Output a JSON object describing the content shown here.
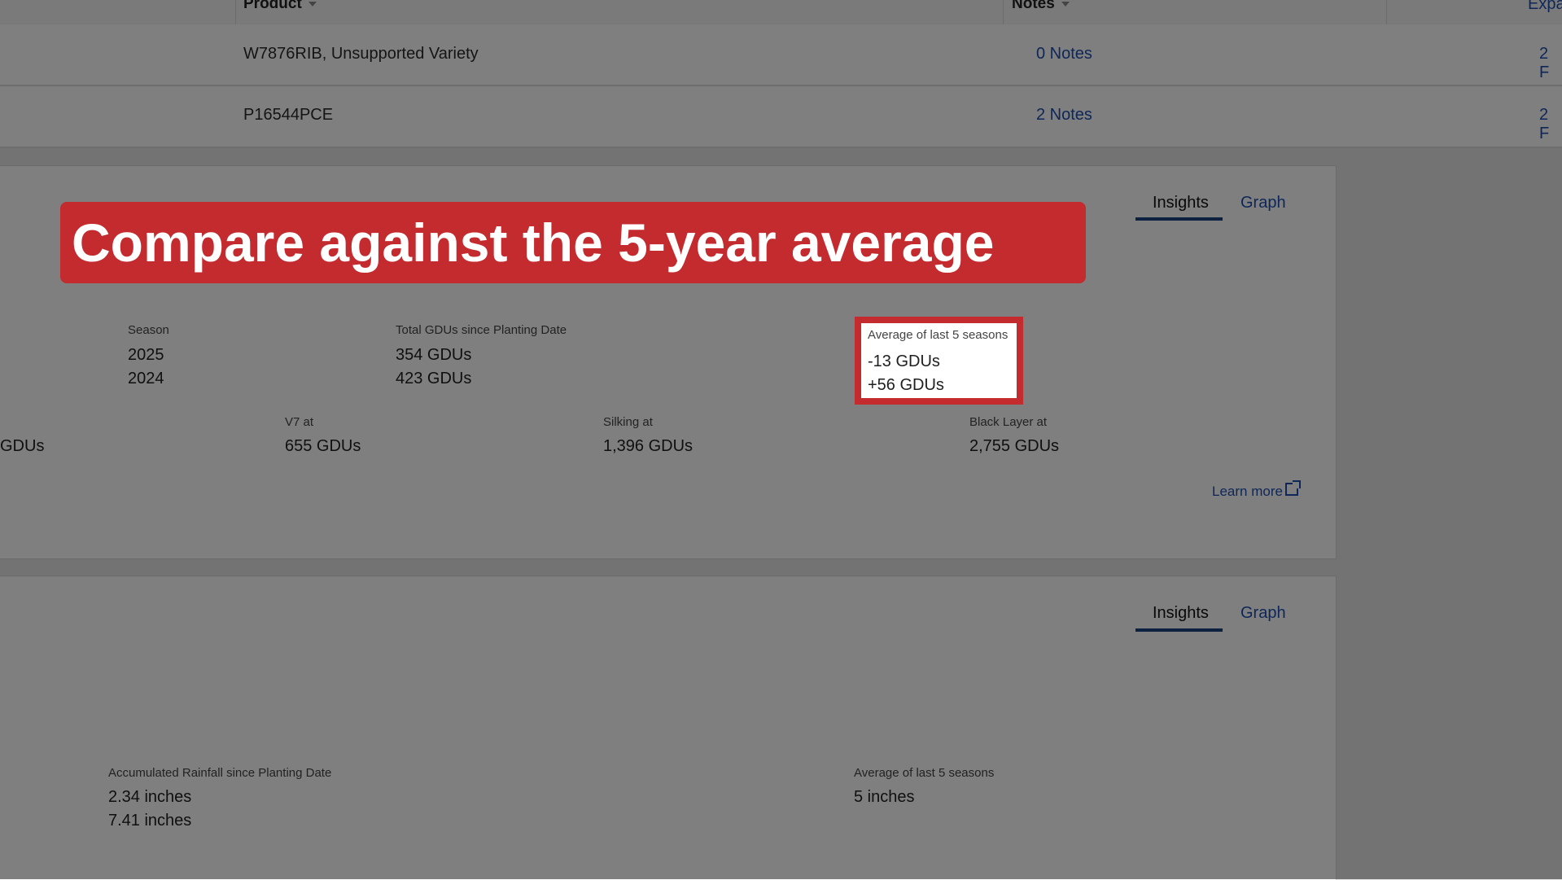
{
  "table": {
    "headers": {
      "product": "Product",
      "notes": "Notes",
      "expand": "Expa"
    },
    "rows": [
      {
        "product": "W7876RIB, Unsupported Variety",
        "notes": "0 Notes",
        "right": "2 F"
      },
      {
        "product": "P16544PCE",
        "notes": "2 Notes",
        "right": "2 F"
      }
    ]
  },
  "gdu_panel": {
    "tabs": {
      "insights": "Insights",
      "graph": "Graph"
    },
    "season_label": "Season",
    "seasons": [
      "2025",
      "2024"
    ],
    "total_label": "Total GDUs since Planting Date",
    "totals": [
      "354 GDUs",
      "423 GDUs"
    ],
    "avg_label": "Average of last 5 seasons",
    "avgs": [
      "-13 GDUs",
      "+56 GDUs"
    ],
    "stages": {
      "partial_value": "GDUs",
      "v7_label": "V7 at",
      "v7_value": "655 GDUs",
      "silking_label": "Silking at",
      "silking_value": "1,396 GDUs",
      "black_label": "Black Layer at",
      "black_value": "2,755 GDUs"
    },
    "learn_more": "Learn more"
  },
  "rain_panel": {
    "tabs": {
      "insights": "Insights",
      "graph": "Graph"
    },
    "accum_label": "Accumulated Rainfall since Planting Date",
    "accum_values": [
      "2.34 inches",
      "7.41 inches"
    ],
    "avg_label": "Average of last 5 seasons",
    "avg_value": "5 inches"
  },
  "banner": {
    "text": "Compare against the 5-year average"
  },
  "colors": {
    "accent_red": "#c32b2f",
    "link_blue": "#1c4fb0",
    "tab_underline": "#16427f"
  }
}
